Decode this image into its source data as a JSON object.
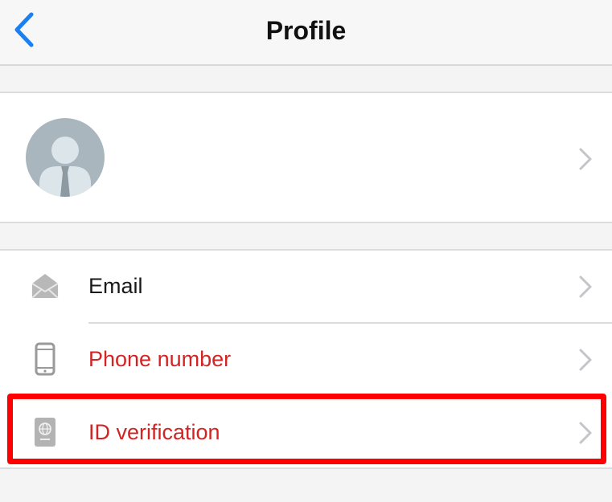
{
  "header": {
    "title": "Profile"
  },
  "profile": {
    "name": ""
  },
  "list": {
    "items": [
      {
        "label": "Email",
        "color": "#1a1a1a",
        "icon": "mail-icon"
      },
      {
        "label": "Phone number",
        "color": "#d22424",
        "icon": "phone-icon"
      },
      {
        "label": "ID verification",
        "color": "#d22424",
        "icon": "passport-icon"
      }
    ]
  },
  "colors": {
    "accent": "#1a7ff0",
    "warning_text": "#d22424",
    "highlight": "#ff0000"
  }
}
